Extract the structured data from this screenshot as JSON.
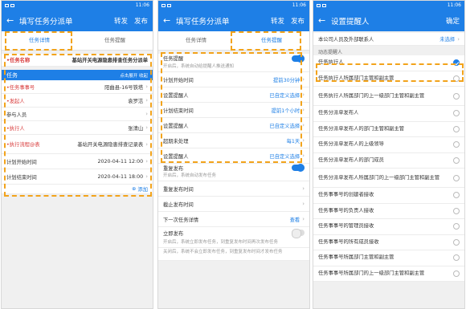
{
  "status": {
    "time": "11:06",
    "time2": "11:06",
    "time3": "11:06"
  },
  "p1": {
    "title": "填写任务分派单",
    "forward": "转发",
    "publish": "发布",
    "tabs": [
      "任务详情",
      "任务提醒"
    ],
    "task_name_label": "任务名称",
    "task_name_value": "基站开关电源隐患排查任务分派单",
    "section_label": "任务",
    "section_right": "点击展开 收起",
    "rows": [
      {
        "label": "任务事事号",
        "value": "阳曲县-16号铁塔",
        "req": true
      },
      {
        "label": "发起人",
        "value": "袁罗洁",
        "req": true
      },
      {
        "label": "参与人员",
        "value": "",
        "req": false
      },
      {
        "label": "执行人",
        "value": "张清山",
        "req": true
      },
      {
        "label": "执行流程@表",
        "value": "基站开关电源隐患排查记录表",
        "req": true
      },
      {
        "label": "计划开始时间",
        "value": "2020-04-11 12:00",
        "req": false
      },
      {
        "label": "计划结束时间",
        "value": "2020-04-11 18:00",
        "req": false
      }
    ],
    "add_label": "添加"
  },
  "p2": {
    "title": "填写任务分派单",
    "forward": "转发",
    "publish": "发布",
    "tabs": [
      "任务详情",
      "任务提醒"
    ],
    "remind_label": "任务提醒",
    "remind_hint": "开启后，系统自动给提醒人推送通知",
    "rows": [
      {
        "label": "计划开始时间",
        "value": "提前30分钟"
      },
      {
        "label": "设置提醒人",
        "value": "已自定义选择"
      },
      {
        "label": "计划结束时间",
        "value": "提前1个小时"
      },
      {
        "label": "设置提醒人",
        "value": "已自定义选择"
      },
      {
        "label": "超期未处理",
        "value": "每1天"
      },
      {
        "label": "设置提醒人",
        "value": "已自定义选择"
      }
    ],
    "repeat_label": "重复发布",
    "repeat_hint": "开启后，系统自动发布任务",
    "repeat_rows": [
      {
        "label": "重复发布时间",
        "value": ""
      },
      {
        "label": "截止发布时间",
        "value": ""
      },
      {
        "label": "下一次任务详情",
        "value": "查看"
      }
    ],
    "immediate_label": "立即发布",
    "immediate_hint1": "开启后，系统立即发布任务，到重复发布时间再次发布任务",
    "immediate_hint2": "关闭后，系统不会立即发布任务，到重复发布时间才发布任务"
  },
  "p3": {
    "title": "设置提醒人",
    "confirm": "确定",
    "company_row": {
      "label": "本公司人员及外部联系人",
      "value": "未选择"
    },
    "section": "动态提醒人",
    "items": [
      "任务执行人",
      "任务执行人所属部门主管和副主管",
      "任务执行人所属部门的上一级部门主管和副主管",
      "任务分派单发布人",
      "任务分派单发布人的部门主管和副主管",
      "任务分派单发布人的上级领导",
      "任务分派单发布人的部门成员",
      "任务分派单发布人所属部门的上一级部门主管和副主管",
      "任务事事号的创建者接收",
      "任务事事号的负责人接收",
      "任务事事号的管理员接收",
      "任务事事号的所有成员接收",
      "任务事事号所属部门主管和副主管",
      "任务事事号所属部门的上一级部门主管和副主管"
    ]
  }
}
